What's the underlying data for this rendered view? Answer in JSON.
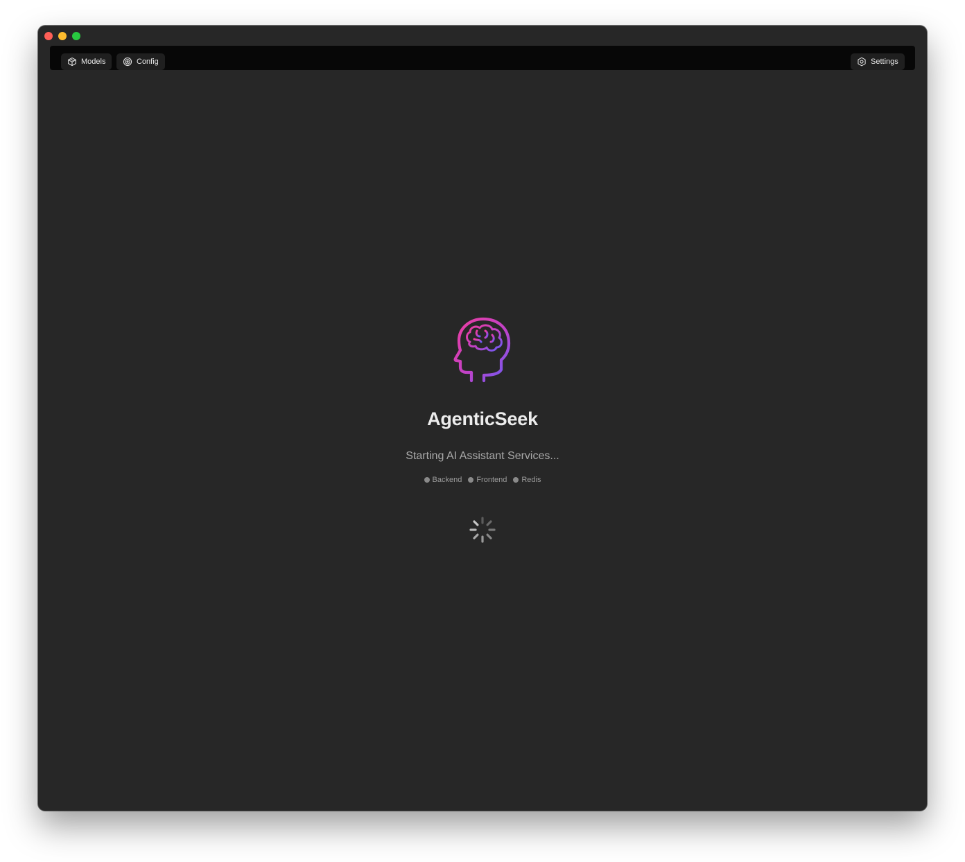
{
  "window": {
    "controls": [
      {
        "name": "close",
        "color": "#fe5f57"
      },
      {
        "name": "minimize",
        "color": "#febc2e"
      },
      {
        "name": "zoom",
        "color": "#28c840"
      }
    ]
  },
  "toolbar": {
    "models_label": "Models",
    "config_label": "Config",
    "settings_label": "Settings"
  },
  "loading": {
    "app_name": "AgenticSeek",
    "status": "Starting AI Assistant Services...",
    "services": [
      {
        "label": "Backend",
        "status_color": "#8a8a8a"
      },
      {
        "label": "Frontend",
        "status_color": "#8a8a8a"
      },
      {
        "label": "Redis",
        "status_color": "#8a8a8a"
      }
    ]
  },
  "colors": {
    "logo_gradient_start": "#ee3da0",
    "logo_gradient_end": "#6a5cf6",
    "spinner": "#bdbdbd"
  }
}
